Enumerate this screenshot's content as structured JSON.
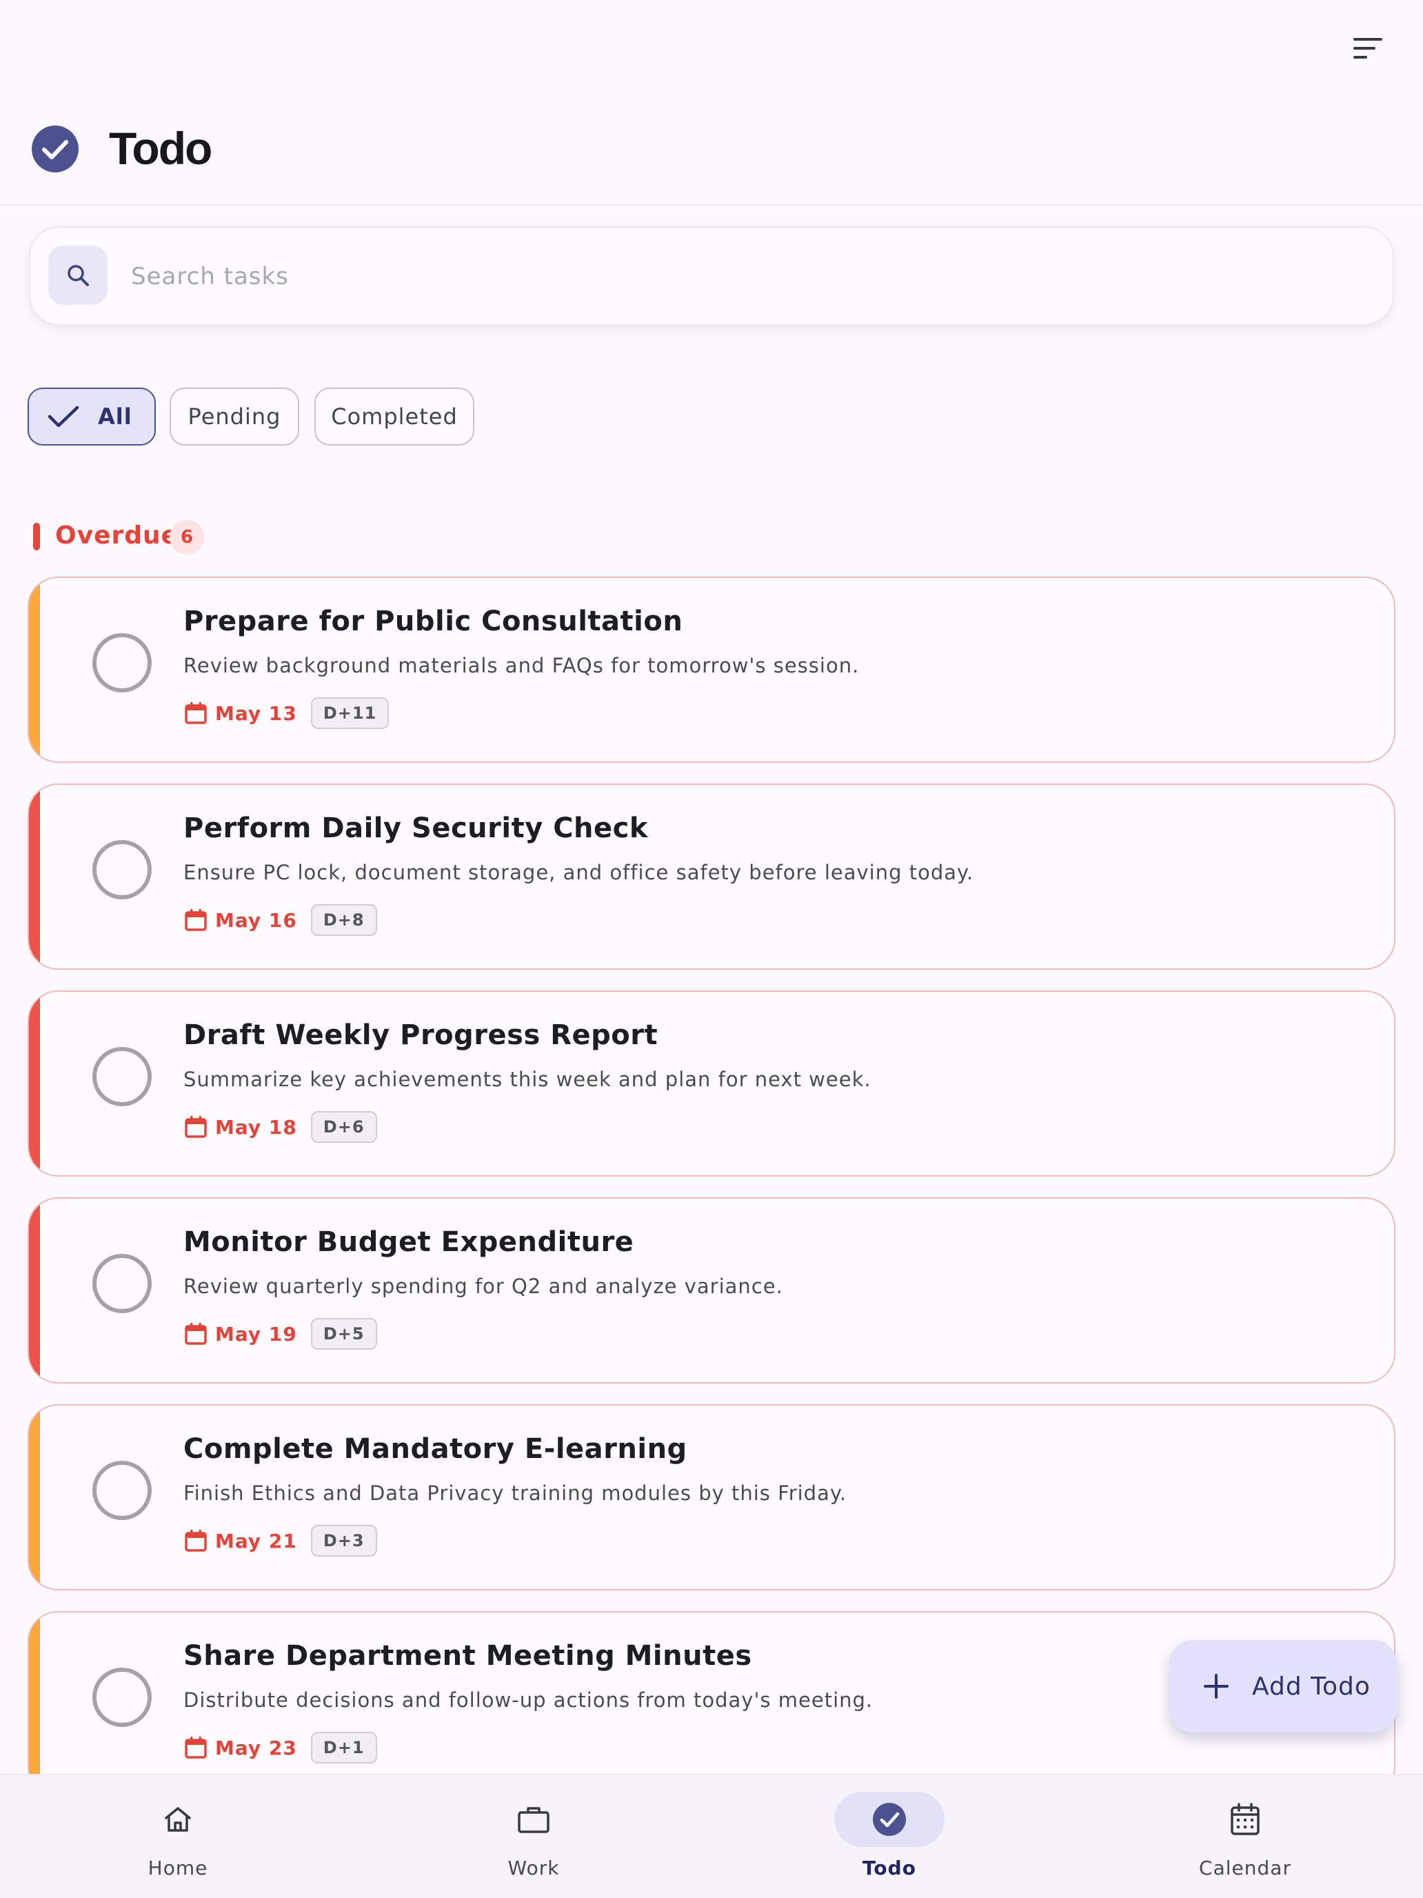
{
  "header": {
    "title": "Todo",
    "menu_icon": "sort-menu-icon",
    "title_icon": "check-circle-icon"
  },
  "search": {
    "placeholder": "Search tasks",
    "value": ""
  },
  "filters": {
    "all": "All",
    "pending": "Pending",
    "completed": "Completed",
    "selected": "All"
  },
  "section": {
    "title": "Overdue",
    "count": "6",
    "color": "#e5433a"
  },
  "todos": [
    {
      "title": "Prepare for Public Consultation",
      "description": "Review background materials and FAQs for tomorrow's session.",
      "date": "May 13",
      "dday": "D+11",
      "priority_color": "#f8a93a"
    },
    {
      "title": "Perform Daily Security Check",
      "description": "Ensure PC lock, document storage, and office safety before leaving today.",
      "date": "May 16",
      "dday": "D+8",
      "priority_color": "#f0514b"
    },
    {
      "title": "Draft Weekly Progress Report",
      "description": "Summarize key achievements this week and plan for next week.",
      "date": "May 18",
      "dday": "D+6",
      "priority_color": "#f0514b"
    },
    {
      "title": "Monitor Budget Expenditure",
      "description": "Review quarterly spending for Q2 and analyze variance.",
      "date": "May 19",
      "dday": "D+5",
      "priority_color": "#f0514b"
    },
    {
      "title": "Complete Mandatory E-learning",
      "description": "Finish Ethics and Data Privacy training modules by this Friday.",
      "date": "May 21",
      "dday": "D+3",
      "priority_color": "#f8a93a"
    },
    {
      "title": "Share Department Meeting Minutes",
      "description": "Distribute decisions and follow-up actions from today's meeting.",
      "date": "May 23",
      "dday": "D+1",
      "priority_color": "#f8a93a"
    }
  ],
  "fab": {
    "label": "Add Todo"
  },
  "nav": {
    "home": "Home",
    "work": "Work",
    "todo": "Todo",
    "calendar": "Calendar",
    "active": "Todo"
  },
  "colors": {
    "accent": "#4c5290",
    "overdue": "#e5433a",
    "background": "#fbf8fe"
  }
}
